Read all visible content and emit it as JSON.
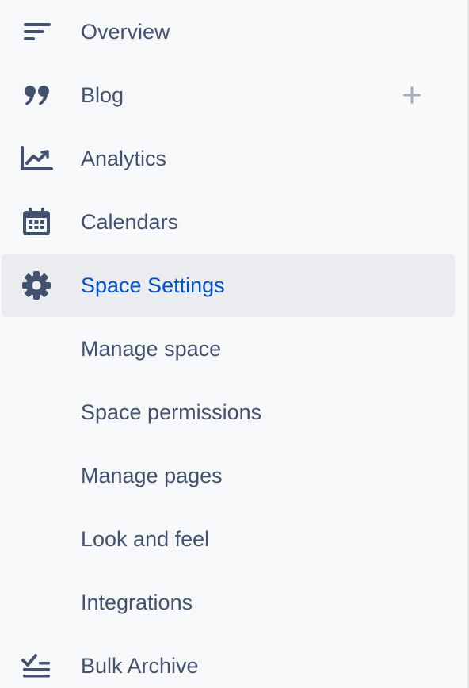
{
  "sidebar": {
    "items": [
      {
        "label": "Overview",
        "icon": "overview-lines-icon"
      },
      {
        "label": "Blog",
        "icon": "quote-icon",
        "action": "plus-icon"
      },
      {
        "label": "Analytics",
        "icon": "line-chart-icon"
      },
      {
        "label": "Calendars",
        "icon": "calendar-icon"
      },
      {
        "label": "Space Settings",
        "icon": "gear-icon",
        "active": true
      },
      {
        "label": "Manage space"
      },
      {
        "label": "Space permissions"
      },
      {
        "label": "Manage pages"
      },
      {
        "label": "Look and feel"
      },
      {
        "label": "Integrations"
      },
      {
        "label": "Bulk Archive",
        "icon": "bulk-archive-icon"
      }
    ]
  },
  "colors": {
    "background": "#f7f8fa",
    "text": "#42526e",
    "active_text": "#0052cc",
    "active_background": "#ebecf0",
    "plus_icon": "#a5adba"
  }
}
